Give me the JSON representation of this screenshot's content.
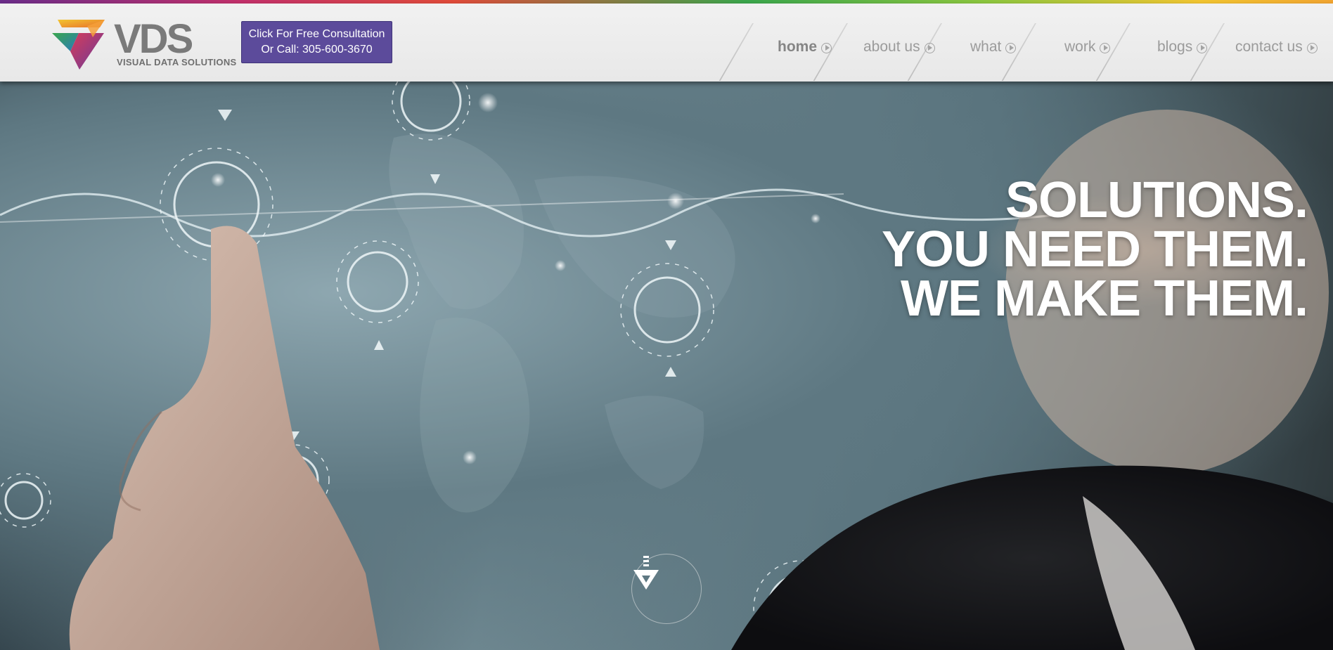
{
  "brand": {
    "name": "VDS",
    "tagline": "VISUAL DATA SOLUTIONS",
    "colors": {
      "purple": "#5c4b9b",
      "orange": "#f2a531",
      "green": "#3aa64c",
      "red": "#d53c5a"
    }
  },
  "cta": {
    "line1": "Click For Free Consultation",
    "line2": "Or Call: 305-600-3670"
  },
  "nav": {
    "items": [
      {
        "label": "home",
        "active": true
      },
      {
        "label": "about us"
      },
      {
        "label": "what"
      },
      {
        "label": "work"
      },
      {
        "label": "blogs"
      },
      {
        "label": "contact us"
      }
    ],
    "arrow_icon": "circle-arrow-right-icon"
  },
  "hero": {
    "lines": [
      "SOLUTIONS.",
      "YOU NEED THEM.",
      "WE MAKE THEM."
    ],
    "scroll_icon": "vds-chevron-down-icon"
  }
}
